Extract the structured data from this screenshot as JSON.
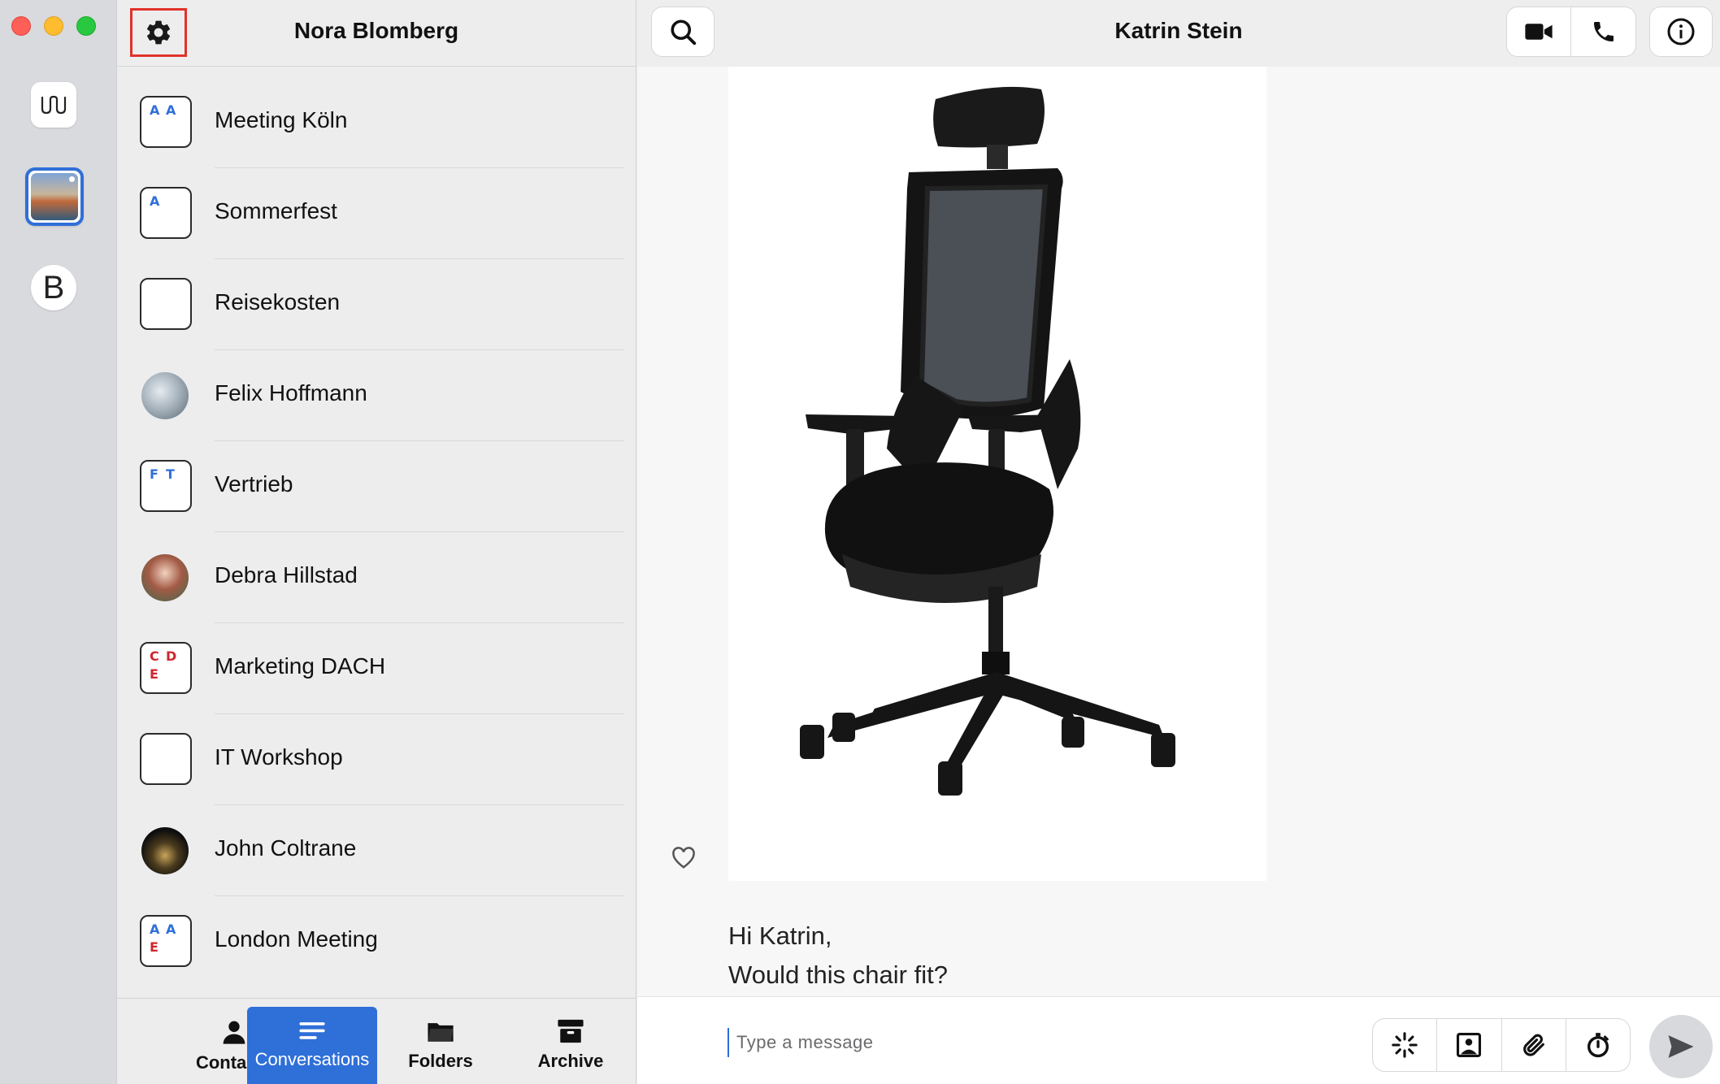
{
  "window": {
    "controls": [
      "close",
      "minimize",
      "zoom"
    ]
  },
  "accounts": {
    "items": [
      {
        "name": "wire-logo",
        "glyph": "ɰ"
      },
      {
        "name": "photo-account"
      },
      {
        "name": "account-b",
        "glyph": "B"
      }
    ],
    "selected_index": 1
  },
  "sidebar": {
    "title": "Nora Blomberg",
    "settings_icon": "gear-icon",
    "conversations": [
      {
        "name": "Meeting Köln",
        "avatar": "group",
        "letters": [
          {
            "t": "A",
            "c": "blue"
          },
          {
            "t": "A",
            "c": "blue"
          }
        ]
      },
      {
        "name": "Sommerfest",
        "avatar": "group",
        "letters": [
          {
            "t": "A",
            "c": "blue"
          }
        ]
      },
      {
        "name": "Reisekosten",
        "avatar": "group",
        "letters": []
      },
      {
        "name": "Felix Hoffmann",
        "avatar": "photo",
        "photo": "felix"
      },
      {
        "name": "Vertrieb",
        "avatar": "group",
        "letters": [
          {
            "t": "F",
            "c": "blue"
          },
          {
            "t": "T",
            "c": "blue"
          }
        ]
      },
      {
        "name": "Debra Hillstad",
        "avatar": "photo",
        "photo": "debra"
      },
      {
        "name": "Marketing DACH",
        "avatar": "group",
        "letters": [
          {
            "t": "C",
            "c": "red"
          },
          {
            "t": "D",
            "c": "red"
          },
          {
            "t": "E",
            "c": "red"
          }
        ]
      },
      {
        "name": "IT Workshop",
        "avatar": "group",
        "letters": []
      },
      {
        "name": "John Coltrane",
        "avatar": "photo",
        "photo": "john"
      },
      {
        "name": "London Meeting",
        "avatar": "group",
        "letters": [
          {
            "t": "A",
            "c": "blue"
          },
          {
            "t": "A",
            "c": "blue"
          },
          {
            "t": "E",
            "c": "red"
          }
        ]
      }
    ]
  },
  "tabs": [
    {
      "id": "contacts",
      "label": "Contacts",
      "icon": "person-icon"
    },
    {
      "id": "conversations",
      "label": "Conversations",
      "icon": "conversations-icon",
      "active": true
    },
    {
      "id": "folders",
      "label": "Folders",
      "icon": "folder-icon"
    },
    {
      "id": "archive",
      "label": "Archive",
      "icon": "archive-icon"
    }
  ],
  "chat": {
    "title": "Katrin Stein",
    "header_buttons": [
      "search-icon",
      "video-camera-icon",
      "phone-icon",
      "info-icon"
    ],
    "image_message": {
      "subject": "office-chair"
    },
    "text_lines": [
      "Hi Katrin,",
      "Would this chair fit?"
    ],
    "composer": {
      "placeholder": "Type a message",
      "value": "",
      "tools": [
        "ping-icon",
        "image-icon",
        "paperclip-icon",
        "timer-icon"
      ]
    }
  },
  "colors": {
    "accent": "#2f6fd8",
    "highlight_box": "#e0322b",
    "traffic_red": "#fe5f57",
    "traffic_yellow": "#febc2e",
    "traffic_green": "#28c840"
  }
}
